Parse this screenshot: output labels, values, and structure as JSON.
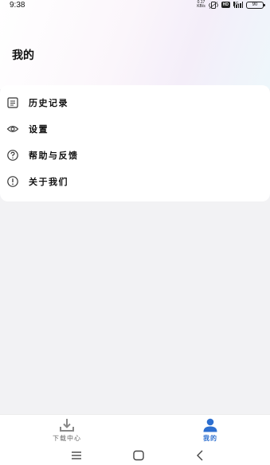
{
  "status_bar": {
    "time": "9:38",
    "net_speed_value": "0.17",
    "net_speed_unit": "KB/s",
    "hd_badge": "HD",
    "signal_label": "5G",
    "battery": "90"
  },
  "header": {
    "title": "我的"
  },
  "menu": {
    "items": [
      {
        "label": "历史记录",
        "icon": "document-icon"
      },
      {
        "label": "设置",
        "icon": "settings-icon"
      },
      {
        "label": "帮助与反馈",
        "icon": "help-icon"
      },
      {
        "label": "关于我们",
        "icon": "info-icon"
      }
    ]
  },
  "bottom_nav": {
    "tabs": [
      {
        "label": "下载中心",
        "icon": "download-icon",
        "active": false
      },
      {
        "label": "我的",
        "icon": "person-icon",
        "active": true
      }
    ]
  },
  "colors": {
    "accent": "#2d6fd0",
    "inactive": "#888888",
    "background": "#f2f2f4"
  }
}
